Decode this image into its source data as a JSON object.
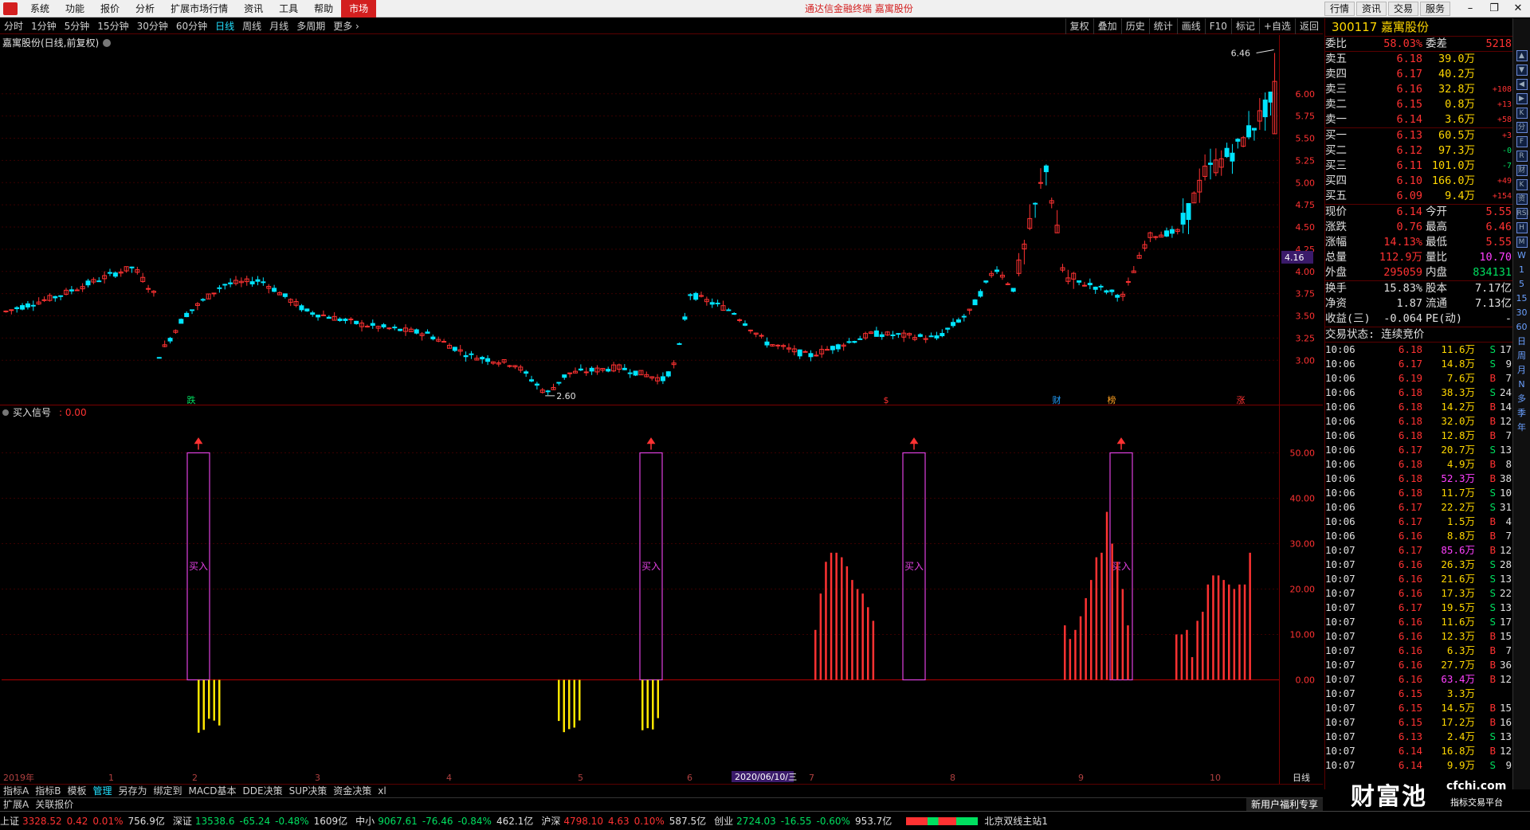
{
  "menubar": {
    "items": [
      "系统",
      "功能",
      "报价",
      "分析",
      "扩展市场行情",
      "资讯",
      "工具",
      "帮助",
      "市场"
    ],
    "center_text": "通达信金融终端  嘉寓股份",
    "right_buttons": [
      "行情",
      "资讯",
      "交易",
      "服务"
    ]
  },
  "toolbar": {
    "periods": [
      "分时",
      "1分钟",
      "5分钟",
      "15分钟",
      "30分钟",
      "60分钟",
      "日线",
      "周线",
      "月线",
      "多周期",
      "更多"
    ],
    "active_period": "日线",
    "right_tools": [
      "复权",
      "叠加",
      "历史",
      "统计",
      "画线",
      "F10",
      "标记",
      "+自选",
      "返回"
    ]
  },
  "chart": {
    "title": "嘉寓股份(日线,前复权)",
    "indicator_title": "买入信号",
    "indicator_value": ": 0.00",
    "price_axis": [
      "6.00",
      "5.75",
      "5.50",
      "5.25",
      "5.00",
      "4.75",
      "4.50",
      "4.25",
      "4.00",
      "3.75",
      "3.50",
      "3.25",
      "3.00"
    ],
    "indicator_axis": [
      "50.00",
      "40.00",
      "30.00",
      "20.00",
      "10.00",
      "0.00"
    ],
    "current_price_tag": "4.16",
    "high_label": "6.46",
    "low_label": "2.60",
    "buy_label": "买入",
    "event_marks": [
      "跌",
      "$",
      "财",
      "榜",
      "涨"
    ],
    "time_axis": [
      "2019年",
      "1",
      "2",
      "3",
      "4",
      "5",
      "6",
      "7",
      "8",
      "9",
      "10"
    ],
    "cursor_date": "2020/06/10/三",
    "period_tag": "日线",
    "colors": {
      "up": "#ff3232",
      "down": "#00e5ff",
      "signal": "#ff3232",
      "neg": "#ffe600",
      "buy_box": "#e040e0",
      "grid": "#3a0000"
    }
  },
  "chart_data": {
    "type": "candlestick",
    "title": "嘉寓股份(日线,前复权)",
    "price_ylim": [
      2.5,
      6.5
    ],
    "high": 6.46,
    "low": 2.6,
    "indicator": {
      "name": "买入信号",
      "ylim": [
        -15,
        55
      ],
      "buy_signal_value": 50,
      "buy_signals_count": 4
    }
  },
  "quote": {
    "code_name": "300117 嘉寓股份",
    "weibi_label": "委比",
    "weibi": "58.03%",
    "weicha_label": "委差",
    "weicha": "5218",
    "asks": [
      {
        "label": "卖五",
        "price": "6.18",
        "vol": "39.0万",
        "chg": ""
      },
      {
        "label": "卖四",
        "price": "6.17",
        "vol": "40.2万",
        "chg": ""
      },
      {
        "label": "卖三",
        "price": "6.16",
        "vol": "32.8万",
        "chg": "+108"
      },
      {
        "label": "卖二",
        "price": "6.15",
        "vol": "0.8万",
        "chg": "+13"
      },
      {
        "label": "卖一",
        "price": "6.14",
        "vol": "3.6万",
        "chg": "+58"
      }
    ],
    "bids": [
      {
        "label": "买一",
        "price": "6.13",
        "vol": "60.5万",
        "chg": "+3"
      },
      {
        "label": "买二",
        "price": "6.12",
        "vol": "97.3万",
        "chg": "-0"
      },
      {
        "label": "买三",
        "price": "6.11",
        "vol": "101.0万",
        "chg": "-7"
      },
      {
        "label": "买四",
        "price": "6.10",
        "vol": "166.0万",
        "chg": "+49"
      },
      {
        "label": "买五",
        "price": "6.09",
        "vol": "9.4万",
        "chg": "+154"
      }
    ],
    "stats": [
      {
        "l1": "现价",
        "v1": "6.14",
        "l2": "今开",
        "v2": "5.55"
      },
      {
        "l1": "涨跌",
        "v1": "0.76",
        "l2": "最高",
        "v2": "6.46"
      },
      {
        "l1": "涨幅",
        "v1": "14.13%",
        "l2": "最低",
        "v2": "5.55"
      },
      {
        "l1": "总量",
        "v1": "112.9万",
        "l2": "量比",
        "v2": "10.70"
      },
      {
        "l1": "外盘",
        "v1": "295059",
        "l2": "内盘",
        "v2": "834131"
      }
    ],
    "stats2": [
      {
        "l1": "换手",
        "v1": "15.83%",
        "l2": "股本",
        "v2": "7.17亿"
      },
      {
        "l1": "净资",
        "v1": "1.87",
        "l2": "流通",
        "v2": "7.13亿"
      },
      {
        "l1": "收益(三)",
        "v1": "-0.064",
        "l2": "PE(动)",
        "v2": "-"
      }
    ],
    "trade_status": "交易状态: 连续竞价"
  },
  "ticks": [
    [
      "10:06",
      "6.18",
      "11.6万",
      "S",
      "17"
    ],
    [
      "10:06",
      "6.17",
      "14.8万",
      "S",
      "9"
    ],
    [
      "10:06",
      "6.19",
      "7.6万",
      "B",
      "7"
    ],
    [
      "10:06",
      "6.18",
      "38.3万",
      "S",
      "24"
    ],
    [
      "10:06",
      "6.18",
      "14.2万",
      "B",
      "14"
    ],
    [
      "10:06",
      "6.18",
      "32.0万",
      "B",
      "12"
    ],
    [
      "10:06",
      "6.18",
      "12.8万",
      "B",
      "7"
    ],
    [
      "10:06",
      "6.17",
      "20.7万",
      "S",
      "13"
    ],
    [
      "10:06",
      "6.18",
      "4.9万",
      "B",
      "8"
    ],
    [
      "10:06",
      "6.18",
      "52.3万",
      "B",
      "38"
    ],
    [
      "10:06",
      "6.18",
      "11.7万",
      "S",
      "10"
    ],
    [
      "10:06",
      "6.17",
      "22.2万",
      "S",
      "31"
    ],
    [
      "10:06",
      "6.17",
      "1.5万",
      "B",
      "4"
    ],
    [
      "10:06",
      "6.16",
      "8.8万",
      "B",
      "7"
    ],
    [
      "10:07",
      "6.17",
      "85.6万",
      "B",
      "12"
    ],
    [
      "10:07",
      "6.16",
      "26.3万",
      "S",
      "28"
    ],
    [
      "10:07",
      "6.16",
      "21.6万",
      "S",
      "13"
    ],
    [
      "10:07",
      "6.16",
      "17.3万",
      "S",
      "22"
    ],
    [
      "10:07",
      "6.17",
      "19.5万",
      "S",
      "13"
    ],
    [
      "10:07",
      "6.16",
      "11.6万",
      "S",
      "17"
    ],
    [
      "10:07",
      "6.16",
      "12.3万",
      "B",
      "15"
    ],
    [
      "10:07",
      "6.16",
      "6.3万",
      "B",
      "7"
    ],
    [
      "10:07",
      "6.16",
      "27.7万",
      "B",
      "36"
    ],
    [
      "10:07",
      "6.16",
      "63.4万",
      "B",
      "12"
    ],
    [
      "10:07",
      "6.15",
      "3.3万",
      "",
      ""
    ],
    [
      "10:07",
      "6.15",
      "14.5万",
      "B",
      "15"
    ],
    [
      "10:07",
      "6.15",
      "17.2万",
      "B",
      "16"
    ],
    [
      "10:07",
      "6.13",
      "2.4万",
      "S",
      "13"
    ],
    [
      "10:07",
      "6.14",
      "16.8万",
      "B",
      "12"
    ],
    [
      "10:07",
      "6.14",
      "9.9万",
      "S",
      "9"
    ]
  ],
  "bottom_tabs": [
    "指标A",
    "指标B",
    "模板",
    "管理",
    "另存为",
    "绑定到",
    "MACD基本",
    "DDE决策",
    "SUP决策",
    "资金决策",
    "xl"
  ],
  "bottom_tabs_active": "管理",
  "sub_tabs": [
    "扩展A",
    "关联报价"
  ],
  "promo": "新用户福利专享",
  "status": [
    {
      "name": "上证",
      "price": "3328.52",
      "chg": "0.42",
      "pct": "0.01%",
      "amt": "756.9亿"
    },
    {
      "name": "深证",
      "price": "13538.6",
      "chg": "-65.24",
      "pct": "-0.48%",
      "amt": "1609亿"
    },
    {
      "name": "中小",
      "price": "9067.61",
      "chg": "-76.46",
      "pct": "-0.84%",
      "amt": "462.1亿"
    },
    {
      "name": "沪深",
      "price": "4798.10",
      "chg": "4.63",
      "pct": "0.10%",
      "amt": "587.5亿"
    },
    {
      "name": "创业",
      "price": "2724.03",
      "chg": "-16.55",
      "pct": "-0.60%",
      "amt": "953.7亿"
    }
  ],
  "server": "北京双线主站1",
  "watermark": {
    "big": "财富池",
    "url": "cfchi.com",
    "sub": "指标交易平台"
  },
  "side_icons": [
    "▲",
    "▼",
    "◀",
    "▶",
    "K",
    "分",
    "F",
    "R",
    "财",
    "K",
    "资",
    "RSI",
    "H",
    "M",
    "W",
    "1",
    "5",
    "15",
    "30",
    "60",
    "日",
    "周",
    "月",
    "N",
    "多",
    "季",
    "年"
  ]
}
